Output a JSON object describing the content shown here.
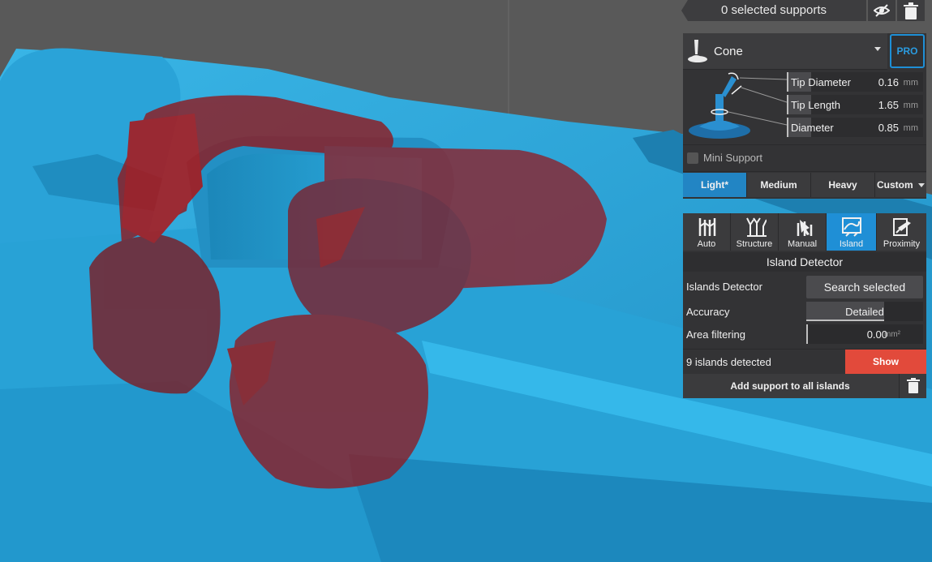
{
  "toolbar": {
    "selected_supports": "0 selected supports",
    "icons": [
      "eye-slash-icon",
      "trash-icon"
    ]
  },
  "support_settings": {
    "type_icon": "cone-support-icon",
    "type": "Cone",
    "pro": "PRO",
    "params": [
      {
        "label": "Tip Diameter",
        "value": "0.16",
        "unit": "mm"
      },
      {
        "label": "Tip Length",
        "value": "1.65",
        "unit": "mm"
      },
      {
        "label": "Diameter",
        "value": "0.85",
        "unit": "mm"
      }
    ],
    "mini_support": "Mini Support",
    "mini_support_checked": false,
    "density": [
      "Light*",
      "Medium",
      "Heavy",
      "Custom"
    ],
    "density_selected": "Light*"
  },
  "island_panel": {
    "tabs": [
      {
        "label": "Auto",
        "icon": "auto-supports-icon"
      },
      {
        "label": "Structure",
        "icon": "structure-supports-icon"
      },
      {
        "label": "Manual",
        "icon": "manual-supports-icon"
      },
      {
        "label": "Island",
        "icon": "island-icon"
      },
      {
        "label": "Proximity",
        "icon": "proximity-icon"
      }
    ],
    "active_tab": "Island",
    "title": "Island Detector",
    "islands_detector_label": "Islands Detector",
    "search_button": "Search selected",
    "accuracy_label": "Accuracy",
    "accuracy_value": "Detailed",
    "area_label": "Area filtering",
    "area_value": "0.00",
    "area_unit": "mm²",
    "detected": "9 islands detected",
    "show_button": "Show",
    "add_all_button": "Add support to all islands"
  },
  "colors": {
    "accent": "#1f8fd6",
    "show_button": "#e24a3b",
    "model": "#2aa6d9",
    "island_highlight": "#a01818",
    "background": "#585858"
  }
}
